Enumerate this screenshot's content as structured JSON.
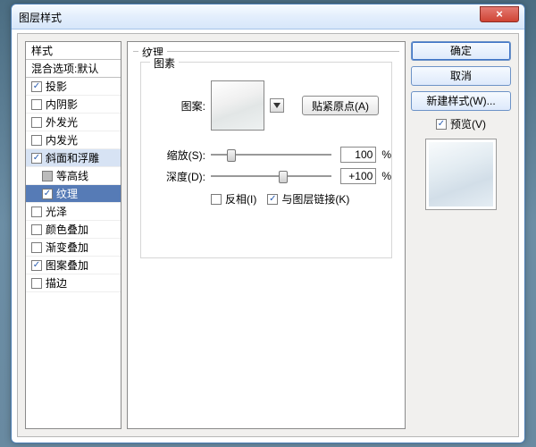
{
  "window": {
    "title": "图层样式",
    "close_glyph": "×"
  },
  "styles": {
    "header": "样式",
    "blend": "混合选项:默认",
    "items": [
      {
        "label": "投影",
        "checked": true
      },
      {
        "label": "内阴影",
        "checked": false
      },
      {
        "label": "外发光",
        "checked": false
      },
      {
        "label": "内发光",
        "checked": false
      },
      {
        "label": "斜面和浮雕",
        "checked": true,
        "group": true
      },
      {
        "label": "等高线",
        "checked": false,
        "sub": true
      },
      {
        "label": "纹理",
        "checked": true,
        "sub": true,
        "selected": true
      },
      {
        "label": "光泽",
        "checked": false
      },
      {
        "label": "颜色叠加",
        "checked": false
      },
      {
        "label": "渐变叠加",
        "checked": false
      },
      {
        "label": "图案叠加",
        "checked": true
      },
      {
        "label": "描边",
        "checked": false
      }
    ]
  },
  "texture": {
    "section": "纹理",
    "pattern": "图素",
    "pattern_label": "图案:",
    "snap": "贴紧原点(A)",
    "scale_label": "缩放(S):",
    "scale_value": "100",
    "depth_label": "深度(D):",
    "depth_value": "+100",
    "percent": "%",
    "invert": "反相(I)",
    "link": "与图层链接(K)",
    "invert_checked": false,
    "link_checked": true
  },
  "buttons": {
    "ok": "确定",
    "cancel": "取消",
    "new_style": "新建样式(W)...",
    "preview": "预览(V)"
  }
}
